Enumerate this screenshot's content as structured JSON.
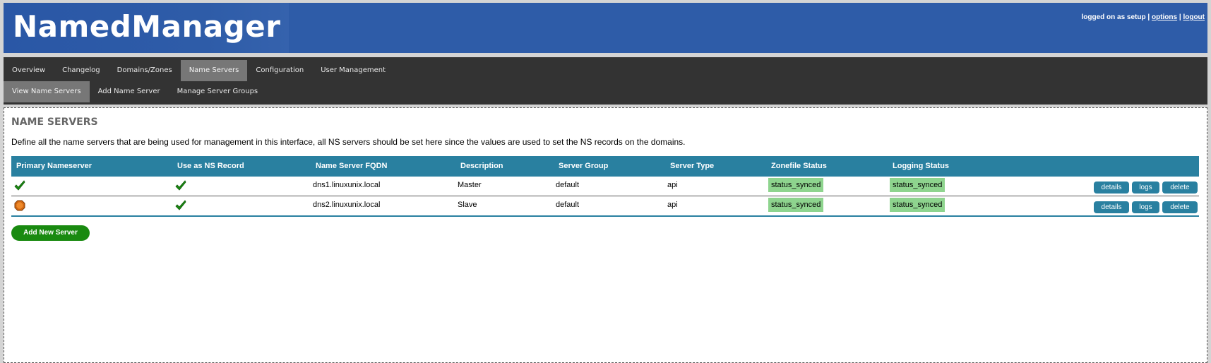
{
  "header": {
    "app_name": "NamedManager",
    "login_text": "logged on as setup",
    "sep1": "|",
    "sep2": "|",
    "options_label": "options",
    "logout_label": "logout"
  },
  "nav": {
    "main_tabs": [
      {
        "label": "Overview"
      },
      {
        "label": "Changelog"
      },
      {
        "label": "Domains/Zones"
      },
      {
        "label": "Name Servers",
        "active": true
      },
      {
        "label": "Configuration"
      },
      {
        "label": "User Management"
      }
    ],
    "sub_tabs": [
      {
        "label": "View Name Servers",
        "active": true
      },
      {
        "label": "Add Name Server"
      },
      {
        "label": "Manage Server Groups"
      }
    ]
  },
  "page": {
    "title": "NAME SERVERS",
    "description": "Define all the name servers that are being used for management in this interface, all NS servers should be set here since the values are used to set the NS records on the domains.",
    "add_button": "Add New Server"
  },
  "table": {
    "headers": [
      "Primary Nameserver",
      "Use as NS Record",
      "Name Server FQDN",
      "Description",
      "Server Group",
      "Server Type",
      "Zonefile Status",
      "Logging Status"
    ],
    "rows": [
      {
        "primary_icon": "check-icon",
        "ns_record_icon": "check-icon",
        "fqdn": "dns1.linuxunix.local",
        "description": "Master",
        "group": "default",
        "type": "api",
        "zonefile_status": "status_synced",
        "logging_status": "status_synced",
        "actions": [
          "details",
          "logs",
          "delete"
        ]
      },
      {
        "primary_icon": "octagon-icon",
        "ns_record_icon": "check-icon",
        "fqdn": "dns2.linuxunix.local",
        "description": "Slave",
        "group": "default",
        "type": "api",
        "zonefile_status": "status_synced",
        "logging_status": "status_synced",
        "actions": [
          "details",
          "logs",
          "delete"
        ]
      }
    ]
  },
  "colors": {
    "header_bg": "#2e5ca8",
    "nav_bg": "#333333",
    "table_header_bg": "#2980a0",
    "status_bg": "#8ed48e",
    "add_button_bg": "#198a10"
  }
}
